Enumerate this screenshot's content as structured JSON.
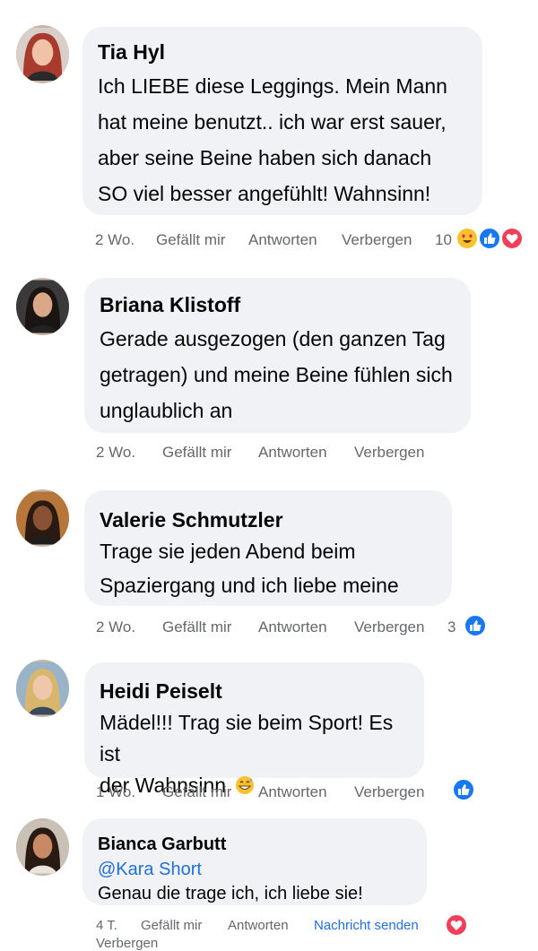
{
  "comments": [
    {
      "author": "Tia Hyl",
      "lines": [
        "Ich LIEBE diese Leggings. Mein Mann",
        "hat meine benutzt.. ich war erst sauer,",
        "aber seine Beine haben sich danach",
        "SO viel besser angefühlt! Wahnsinn!"
      ],
      "time": "2 Wo.",
      "like": "Gefällt mir",
      "reply": "Antworten",
      "hide": "Verbergen",
      "reaction_count": "10",
      "reactions": [
        "love-eyes-emoji",
        "like-icon",
        "heart-icon"
      ]
    },
    {
      "author": "Briana Klistoff",
      "lines": [
        "Gerade ausgezogen (den ganzen Tag",
        "getragen) und meine Beine fühlen sich",
        "unglaublich an"
      ],
      "time": "2 Wo.",
      "like": "Gefällt mir",
      "reply": "Antworten",
      "hide": "Verbergen"
    },
    {
      "author": "Valerie Schmutzler",
      "lines": [
        "Trage sie jeden Abend beim",
        "Spaziergang und ich liebe meine"
      ],
      "time": "2 Wo.",
      "like": "Gefällt mir",
      "reply": "Antworten",
      "hide": "Verbergen",
      "reaction_count": "3",
      "reactions": [
        "like-icon"
      ]
    },
    {
      "author": "Heidi Peiselt",
      "lines": [
        "Mädel!!! Trag sie beim Sport! Es ist",
        "der Wahnsinn"
      ],
      "emoji": "grinning-sweat-emoji",
      "time": "1 Wo.",
      "like": "Gefällt mir",
      "reply": "Antworten",
      "hide": "Verbergen",
      "reactions": [
        "like-icon"
      ]
    },
    {
      "author": "Bianca Garbutt",
      "mention": "@Kara Short",
      "lines": [
        "Genau die trage ich, ich liebe sie!"
      ],
      "time": "4 T.",
      "like": "Gefällt mir",
      "reply": "Antworten",
      "message": "Nachricht senden",
      "hide": "Verbergen",
      "reactions": [
        "heart-icon"
      ]
    }
  ],
  "colors": {
    "bubble": "#f0f2f5",
    "meta": "#65676b",
    "link": "#216fdb",
    "like": "#1877f2",
    "love": "#f33e58"
  }
}
